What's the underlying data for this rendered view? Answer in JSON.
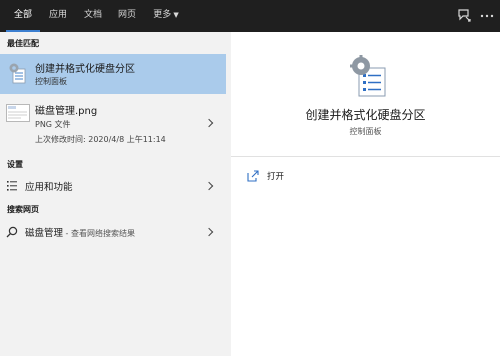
{
  "tabs": [
    {
      "label": "全部"
    },
    {
      "label": "应用"
    },
    {
      "label": "文档"
    },
    {
      "label": "网页"
    },
    {
      "label": "更多"
    }
  ],
  "colors": {
    "topbar": "#1f1f1f",
    "selected": "#aacbeb",
    "accent": "#3c7fd0"
  },
  "left": {
    "section_best": "最佳匹配",
    "best": {
      "title": "创建并格式化硬盘分区",
      "subtitle": "控制面板",
      "icon": "control-panel-icon"
    },
    "file": {
      "name": "磁盘管理.png",
      "type": "PNG 文件",
      "modified": "上次修改时间: 2020/4/8 上午11:14",
      "icon": "image-file-icon"
    },
    "section_settings": "设置",
    "settings_item": {
      "label": "应用和功能",
      "icon": "apps-list-icon"
    },
    "section_web": "搜索网页",
    "web_item": {
      "label": "磁盘管理",
      "suffix": " - 查看网络搜索结果",
      "icon": "search-icon"
    }
  },
  "right": {
    "title": "创建并格式化硬盘分区",
    "subtitle": "控制面板",
    "open_label": "打开",
    "icon": "control-panel-large-icon"
  }
}
